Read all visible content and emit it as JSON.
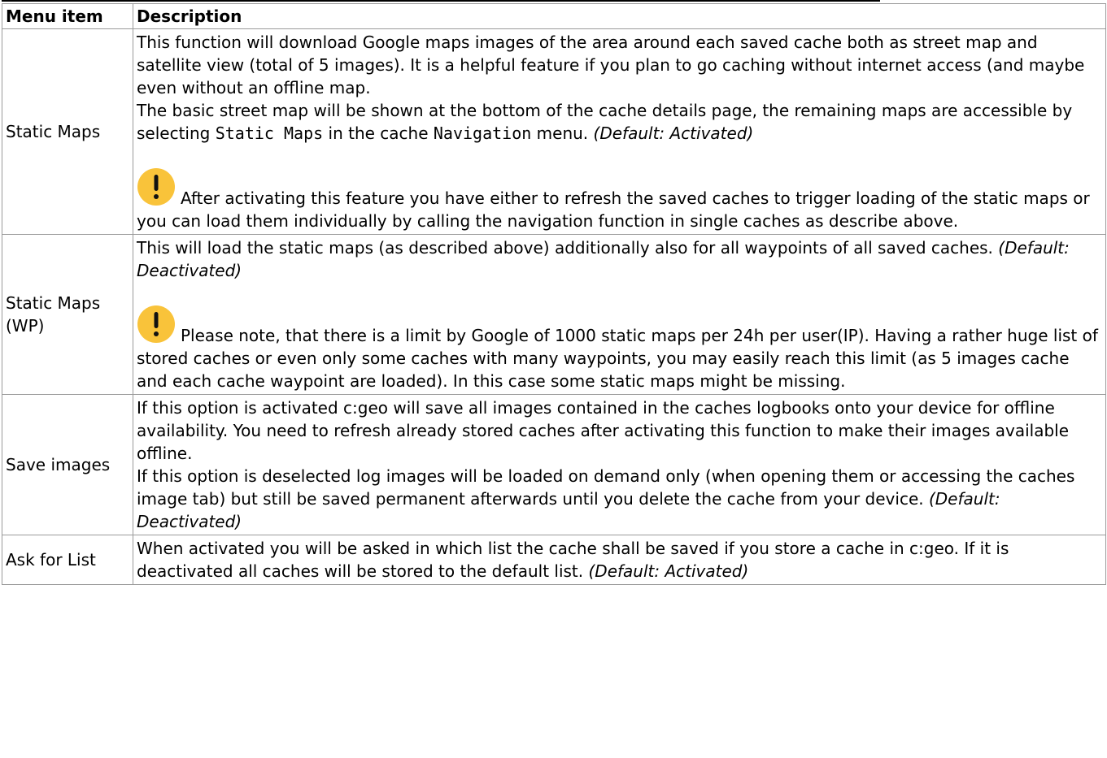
{
  "table": {
    "headers": {
      "item": "Menu item",
      "description": "Description"
    },
    "rows": [
      {
        "item": "Static Maps",
        "p1": "This function will download Google maps images of the area around each saved cache both as street map and satellite view (total of 5 images). It is a helpful feature if you plan to go caching without internet access (and maybe even without an offline map.",
        "p2_a": "The basic street map will be shown at the bottom of the cache details page, the remaining maps are accessible by selecting ",
        "p2_code1": "Static Maps",
        "p2_b": " in the cache ",
        "p2_code2": "Navigation",
        "p2_c": " menu. ",
        "p2_default": "(Default: Activated)",
        "notice_icon": "exclamation-circle-icon",
        "notice": "After activating this feature you have either to refresh the saved caches to trigger loading of the static maps or you can load them individually by calling the navigation function in single caches as describe above."
      },
      {
        "item": "Static Maps (WP)",
        "p1_a": "This will load the static maps (as described above) additionally also for all waypoints of all saved caches. ",
        "p1_default": "(Default: Deactivated)",
        "notice_icon": "exclamation-circle-icon",
        "notice": "Please note, that there is a limit by Google of 1000 static maps per 24h per user(IP). Having a rather huge list of stored caches or even only some caches with many waypoints, you may easily reach this limit (as 5 images cache and each cache waypoint are loaded). In this case some static maps might be missing."
      },
      {
        "item": "Save images",
        "p1": "If this option is activated c:geo will save all images contained in the caches logbooks onto your device for offline availability. You need to refresh already stored caches after activating this function to make their images available offline.",
        "p2_a": "If this option is deselected log images will be loaded on demand only (when opening them or accessing the caches image tab) but still be saved permanent afterwards until you delete the cache from your device. ",
        "p2_default": "(Default: Deactivated)"
      },
      {
        "item": "Ask for List",
        "p1_a": "When activated you will be asked in which list the cache shall be saved if you store a cache in c:geo. If it is deactivated all caches will be stored to the default list. ",
        "p1_default": "(Default: Activated)"
      }
    ]
  },
  "colors": {
    "notice_icon": "#f9c33a",
    "border": "#9a9a9a"
  }
}
